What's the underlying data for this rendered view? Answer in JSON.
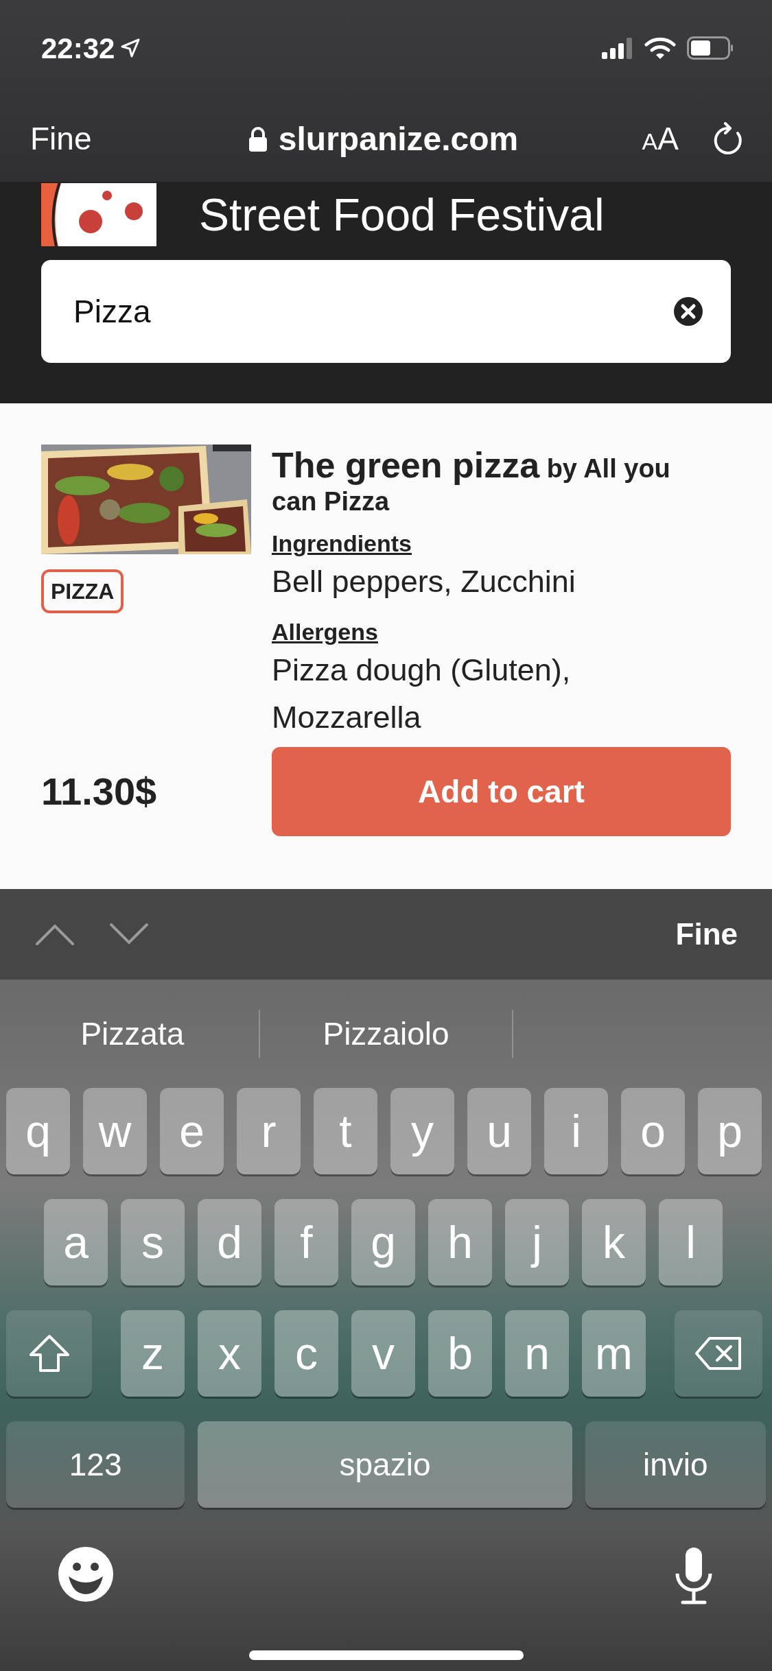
{
  "status_bar": {
    "time": "22:32"
  },
  "browser_bar": {
    "done": "Fine",
    "url": "slurpanize.com",
    "text_size": "AA"
  },
  "header": {
    "title": "Street Food Festival",
    "search": {
      "value": "Pizza"
    }
  },
  "product": {
    "name": "The green pizza",
    "vendor": "by All you can Pizza",
    "tag": "PIZZA",
    "ingredients_label": "Ingrendients",
    "ingredients": "Bell peppers, Zucchini",
    "allergens_label": "Allergens",
    "allergens": "Pizza dough (Gluten), Mozzarella",
    "price": "11.30$",
    "button": "Add to cart"
  },
  "keyboard": {
    "toolbar": {
      "done": "Fine"
    },
    "suggestions": [
      "Pizzata",
      "Pizzaiolo"
    ],
    "key_rows": [
      {
        "keys": [
          {
            "kind": "letter",
            "label": "q"
          },
          {
            "kind": "letter",
            "label": "w"
          },
          {
            "kind": "letter",
            "label": "e"
          },
          {
            "kind": "letter",
            "label": "r"
          },
          {
            "kind": "letter",
            "label": "t"
          },
          {
            "kind": "letter",
            "label": "y"
          },
          {
            "kind": "letter",
            "label": "u"
          },
          {
            "kind": "letter",
            "label": "i"
          },
          {
            "kind": "letter",
            "label": "o"
          },
          {
            "kind": "letter",
            "label": "p"
          }
        ]
      },
      {
        "keys": [
          {
            "kind": "letter",
            "label": "a"
          },
          {
            "kind": "letter",
            "label": "s"
          },
          {
            "kind": "letter",
            "label": "d"
          },
          {
            "kind": "letter",
            "label": "f"
          },
          {
            "kind": "letter",
            "label": "g"
          },
          {
            "kind": "letter",
            "label": "h"
          },
          {
            "kind": "letter",
            "label": "j"
          },
          {
            "kind": "letter",
            "label": "k"
          },
          {
            "kind": "letter",
            "label": "l"
          }
        ]
      },
      {
        "keys": [
          {
            "kind": "shift"
          },
          {
            "kind": "letter",
            "label": "z"
          },
          {
            "kind": "letter",
            "label": "x"
          },
          {
            "kind": "letter",
            "label": "c"
          },
          {
            "kind": "letter",
            "label": "v"
          },
          {
            "kind": "letter",
            "label": "b"
          },
          {
            "kind": "letter",
            "label": "n"
          },
          {
            "kind": "letter",
            "label": "m"
          },
          {
            "kind": "backspace"
          }
        ]
      },
      {
        "keys": [
          {
            "kind": "numbers",
            "label": "123"
          },
          {
            "kind": "space",
            "label": "spazio"
          },
          {
            "kind": "return",
            "label": "invio"
          }
        ]
      }
    ]
  }
}
